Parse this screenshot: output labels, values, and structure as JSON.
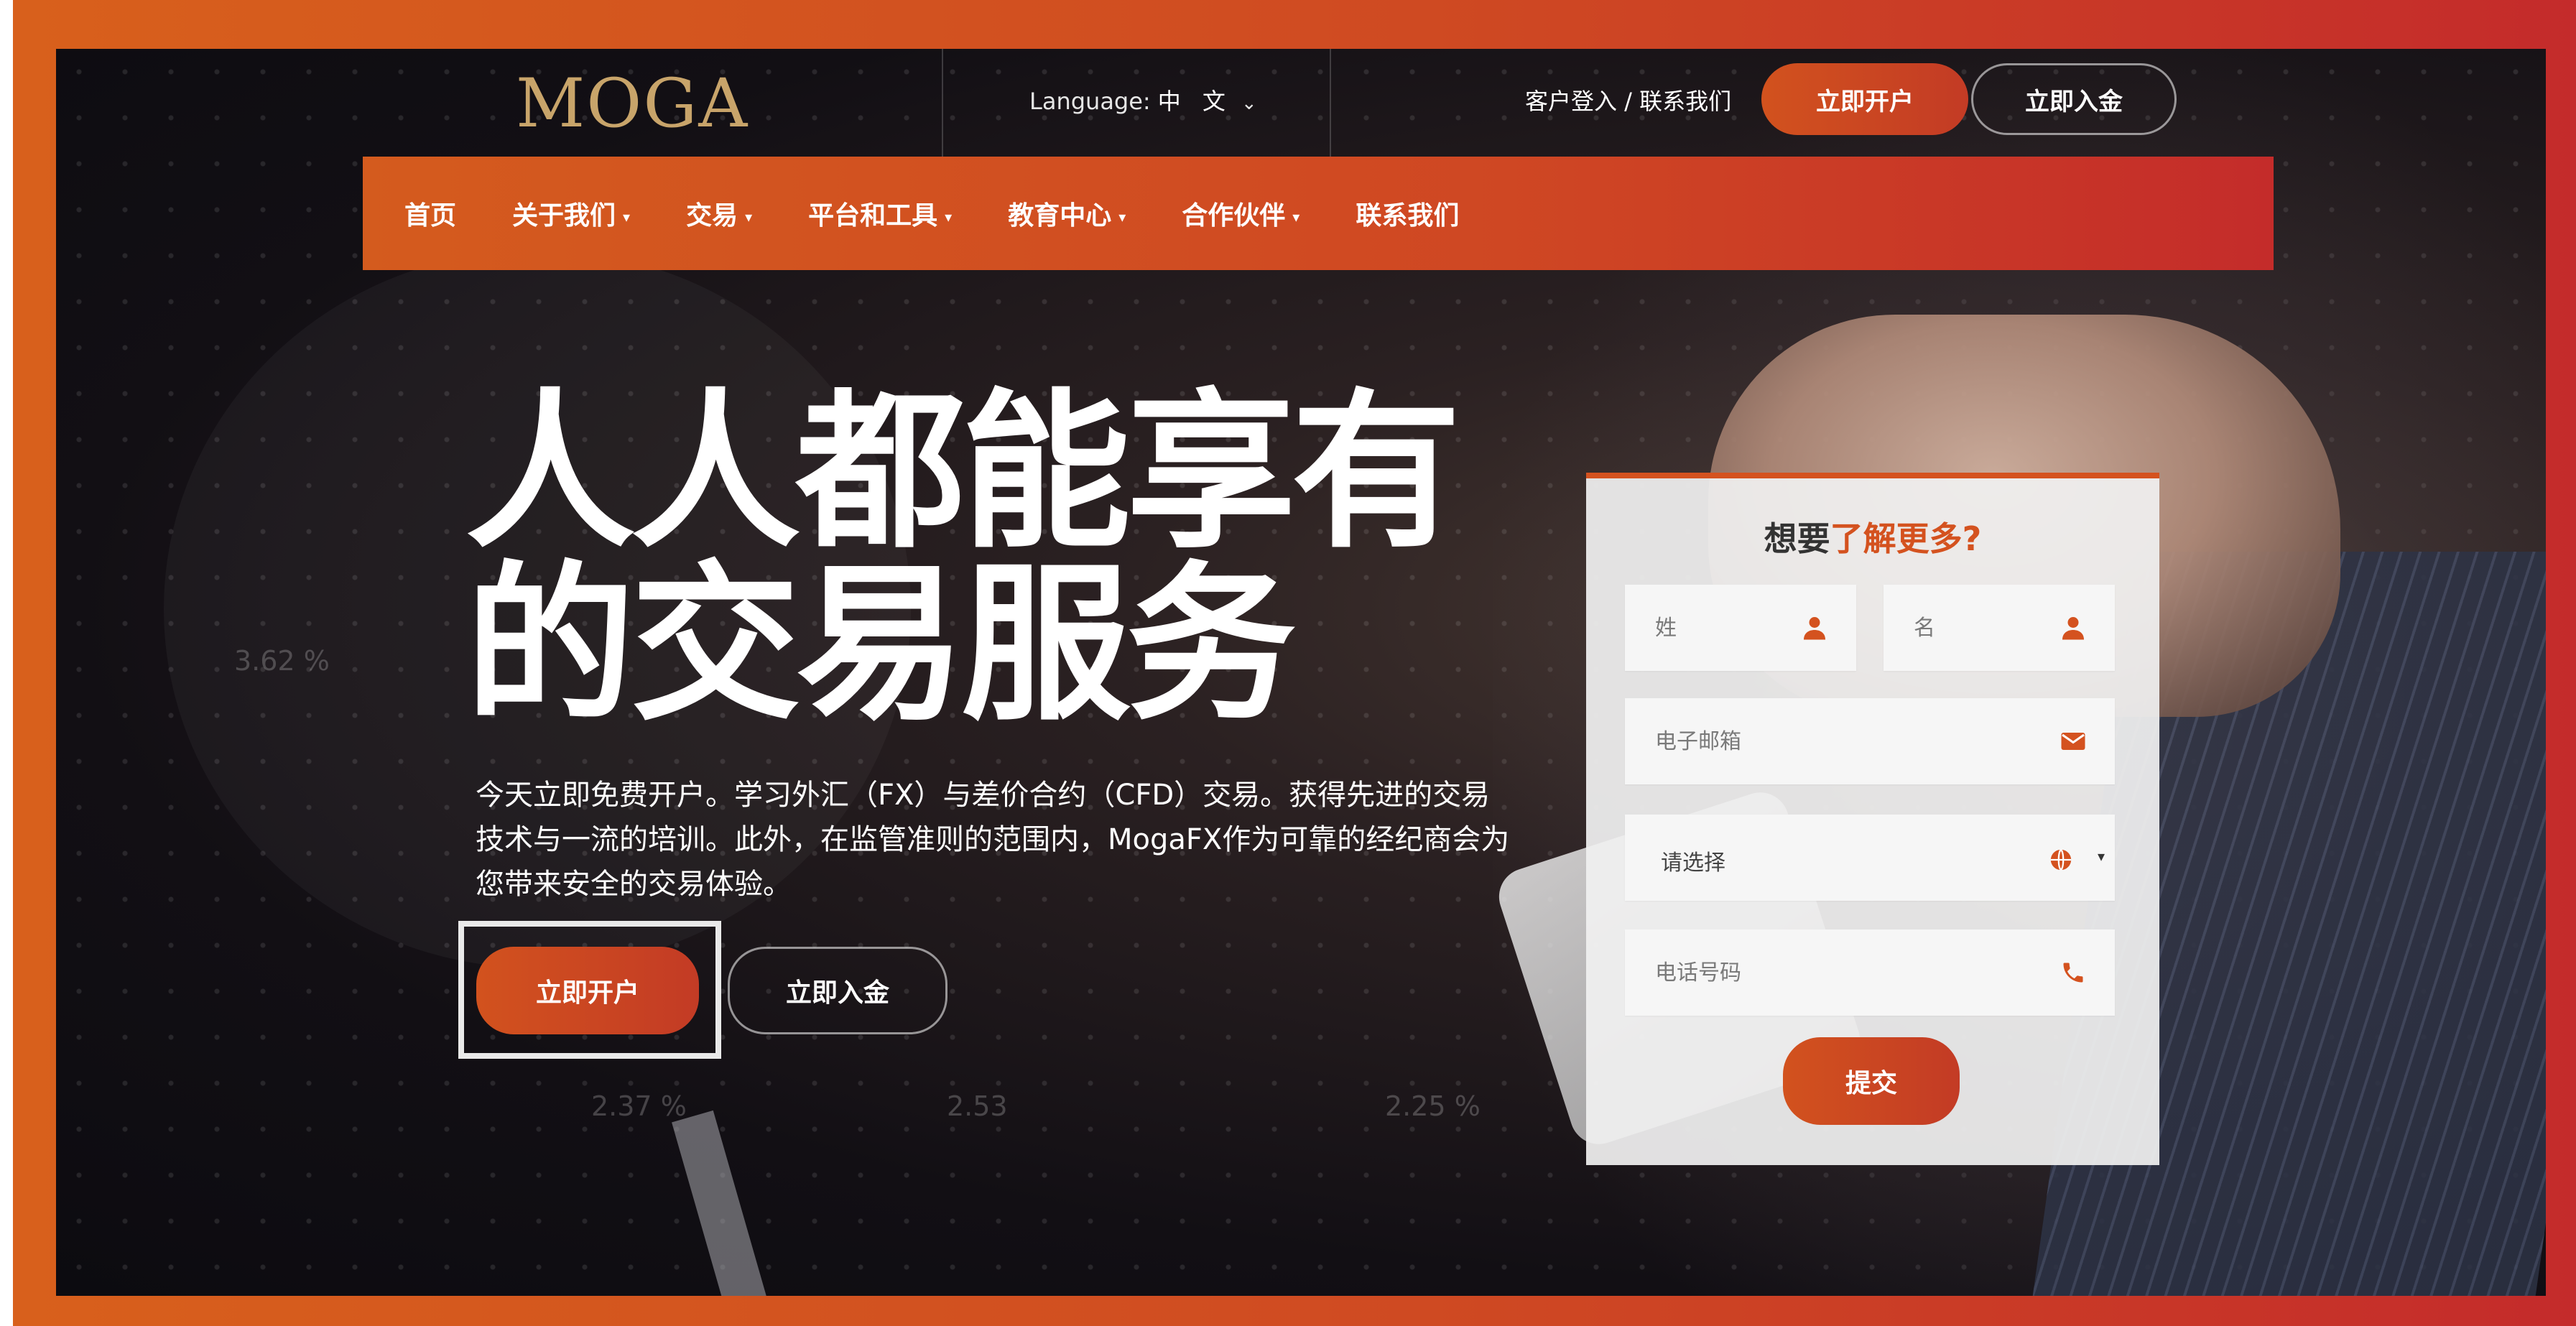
{
  "brand": {
    "logo_text": "MOGA",
    "accent_color": "#d4521f",
    "gold_color": "#c8a46a"
  },
  "header": {
    "language_label": "Language:",
    "language_value": "中 文",
    "links_text": "客户登入 / 联系我们",
    "open_account_label": "立即开户",
    "deposit_label": "立即入金"
  },
  "nav": {
    "items": [
      {
        "label": "首页",
        "has_dropdown": false
      },
      {
        "label": "关于我们",
        "has_dropdown": true
      },
      {
        "label": "交易",
        "has_dropdown": true
      },
      {
        "label": "平台和工具",
        "has_dropdown": true
      },
      {
        "label": "教育中心",
        "has_dropdown": true
      },
      {
        "label": "合作伙伴",
        "has_dropdown": true
      },
      {
        "label": "联系我们",
        "has_dropdown": false
      }
    ]
  },
  "hero": {
    "title_line1": "人人都能享有",
    "title_line2": "的交易服务",
    "description": "今天立即免费开户。学习外汇（FX）与差价合约（CFD）交易。获得先进的交易技术与一流的培训。此外，在监管准则的范围内，MogaFX作为可靠的经纪商会为您带来安全的交易体验。",
    "open_account_label": "立即开户",
    "deposit_label": "立即入金",
    "bg_stats": [
      "3.62 %",
      "2.37 %",
      "2.53",
      "2.25 %"
    ]
  },
  "form": {
    "title_plain": "想要",
    "title_accent": "了解更多?",
    "last_name_placeholder": "姓",
    "first_name_placeholder": "名",
    "email_placeholder": "电子邮箱",
    "country_select_value": "请选择",
    "phone_placeholder": "电话号码",
    "submit_label": "提交"
  },
  "icons": [
    "user-icon",
    "envelope-icon",
    "globe-icon",
    "phone-icon",
    "chevron-down-icon",
    "caret-down-icon"
  ]
}
